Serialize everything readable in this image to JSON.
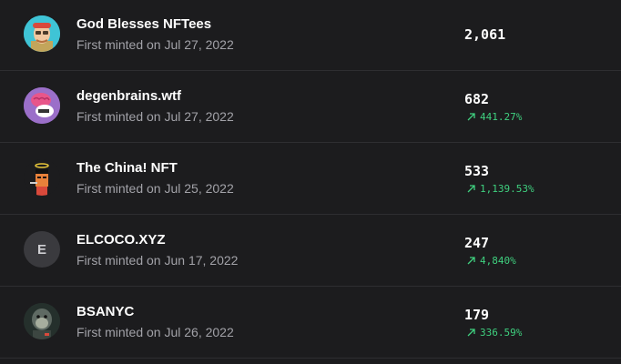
{
  "colors": {
    "background": "#1c1c1e",
    "divider": "#2e2e31",
    "positive": "#3fd07f",
    "secondary_text": "#a2a2a8"
  },
  "collections": [
    {
      "name": "God Blesses NFTees",
      "minted": "First minted on Jul 27, 2022",
      "value": "2,061",
      "change": "",
      "avatar_icon": "cartoon-character-avatar-icon"
    },
    {
      "name": "degenbrains.wtf",
      "minted": "First minted on Jul 27, 2022",
      "value": "682",
      "change": "441.27%",
      "change_icon": "trend-up-arrow-icon",
      "avatar_icon": "brain-character-avatar-icon"
    },
    {
      "name": "The China! NFT",
      "minted": "First minted on Jul 25, 2022",
      "value": "533",
      "change": "1,139.53%",
      "change_icon": "trend-up-arrow-icon",
      "avatar_icon": "pixel-character-avatar-icon"
    },
    {
      "name": "ELCOCO.XYZ",
      "minted": "First minted on Jun 17, 2022",
      "value": "247",
      "change": "4,840%",
      "change_icon": "trend-up-arrow-icon",
      "avatar_letter": "E"
    },
    {
      "name": "BSANYC",
      "minted": "First minted on Jul 26, 2022",
      "value": "179",
      "change": "336.59%",
      "change_icon": "trend-up-arrow-icon",
      "avatar_icon": "ape-character-avatar-icon"
    }
  ]
}
